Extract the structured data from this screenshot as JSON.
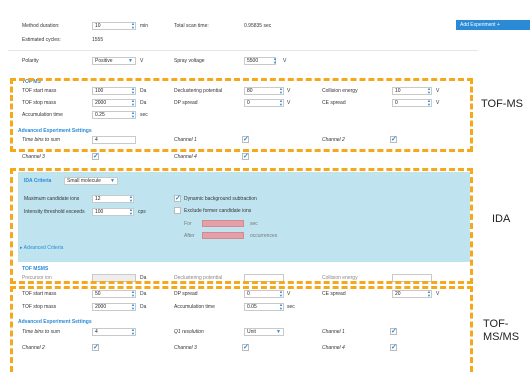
{
  "top": {
    "method_duration_label": "Method duration:",
    "method_duration_value": "10",
    "method_duration_unit": "min",
    "total_scan_time_label": "Total scan time:",
    "total_scan_time_value": "0.95835 sec",
    "estimated_cycles_label": "Estimated cycles:",
    "estimated_cycles_value": "1555",
    "add_experiment_label": "Add Experiment",
    "polarity_label": "Polarity",
    "polarity_value": "Positive",
    "polarity_unit": "V",
    "spray_voltage_label": "Spray voltage",
    "spray_voltage_value": "5500",
    "spray_voltage_unit": "V"
  },
  "tofms": {
    "title": "TOF MS",
    "start_mass_label": "TOF start mass",
    "start_mass_value": "100",
    "start_mass_unit": "Da",
    "declustering_label": "Declustering potential",
    "declustering_value": "80",
    "declustering_unit": "V",
    "collision_energy_label": "Collision energy",
    "collision_energy_value": "10",
    "collision_energy_unit": "V",
    "stop_mass_label": "TOF stop mass",
    "stop_mass_value": "2000",
    "stop_mass_unit": "Da",
    "dp_spread_label": "DP spread",
    "dp_spread_value": "0",
    "dp_spread_unit": "V",
    "ce_spread_label": "CE spread",
    "ce_spread_value": "0",
    "ce_spread_unit": "V",
    "accum_label": "Accumulation time",
    "accum_value": "0.25",
    "accum_unit": "sec",
    "adv_title": "Advanced Experiment Settings",
    "time_bins_label": "Time bins to sum",
    "time_bins_value": "4",
    "channel1": "Channel 1",
    "channel2": "Channel 2",
    "channel3": "Channel 3",
    "channel4": "Channel 4"
  },
  "ida": {
    "criteria_label": "IDA Criteria",
    "criteria_value": "Small molecule",
    "max_candidate_label": "Maximum candidate ions",
    "max_candidate_value": "12",
    "intensity_label": "Intensity threshold exceeds",
    "intensity_value": "100",
    "intensity_unit": "cps",
    "dynamic_bg_label": "Dynamic background subtraction",
    "exclude_label": "Exclude former candidate ions",
    "for_label": "For",
    "for_unit": "sec",
    "after_label": "After",
    "after_unit": "occurrences",
    "advanced_criteria": "Advanced Criteria"
  },
  "tofmsms": {
    "title": "TOF MSMS",
    "precursor_label": "Precursor ion",
    "precursor_unit": "Da",
    "declustering_label": "Declustering potential",
    "collision_energy_label": "Collision energy",
    "start_mass_label": "TOF start mass",
    "start_mass_value": "50",
    "start_mass_unit": "Da",
    "dp_spread_label": "DP spread",
    "dp_spread_value": "0",
    "dp_spread_unit": "V",
    "ce_spread_label": "CE spread",
    "ce_spread_value": "20",
    "ce_spread_unit": "V",
    "stop_mass_label": "TOF stop mass",
    "stop_mass_value": "2000",
    "stop_mass_unit": "Da",
    "accum_label": "Accumulation time",
    "accum_value": "0.05",
    "accum_unit": "sec",
    "adv_title": "Advanced Experiment Settings",
    "time_bins_label": "Time bins to sum",
    "time_bins_value": "4",
    "q1_label": "Q1 resolution",
    "q1_value": "Unit",
    "channel1": "Channel 1",
    "channel2": "Channel 2",
    "channel3": "Channel 3",
    "channel4": "Channel 4"
  },
  "annotations": {
    "tofms": "TOF-MS",
    "ida": "IDA",
    "tofmsms_line1": "TOF-",
    "tofmsms_line2": "MS/MS"
  },
  "colors": {
    "accent": "#2a8ad6",
    "ida_panel": "#bfe4ef",
    "dash": "#f5a81c"
  }
}
